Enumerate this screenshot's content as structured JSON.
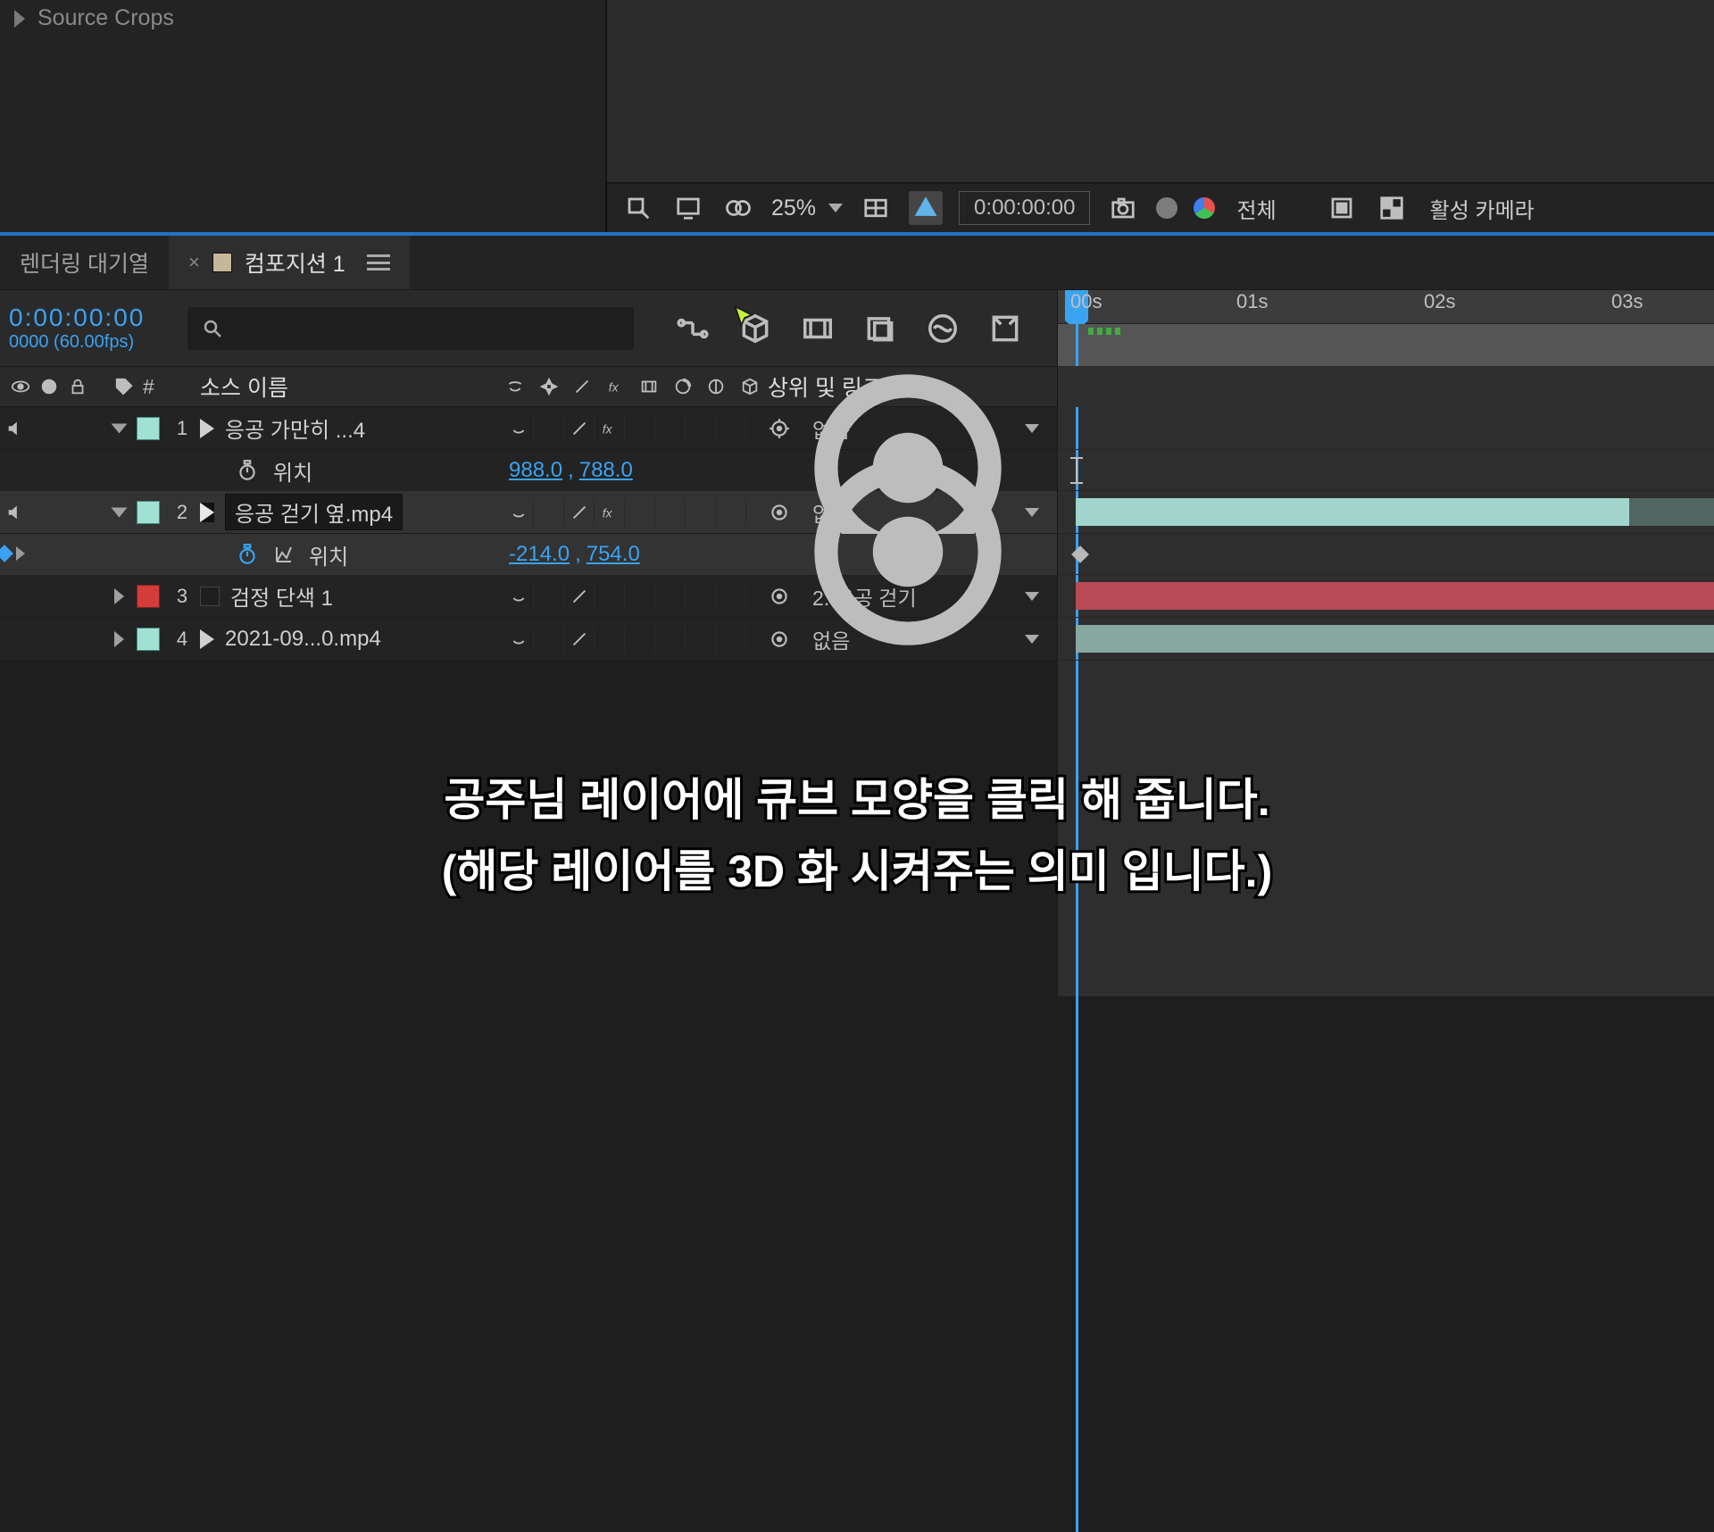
{
  "project": {
    "source_crops": "Source Crops"
  },
  "preview_toolbar": {
    "zoom": "25%",
    "timecode": "0:00:00:00",
    "resolution": "전체",
    "camera": "활성 카메라"
  },
  "tabs": {
    "render_queue": "렌더링 대기열",
    "comp": "컴포지션 1"
  },
  "timeline": {
    "current_time": "0:00:00:00",
    "fps": "0000 (60.00fps)",
    "search_placeholder": "",
    "ruler": [
      "00s",
      "01s",
      "02s",
      "03s"
    ]
  },
  "columns": {
    "index": "#",
    "source_name": "소스 이름",
    "parent_link": "상위 및 링크"
  },
  "layers": [
    {
      "index": "1",
      "name": "응공 가만히 ...4",
      "has_fx": true,
      "parent": "없음",
      "color": "teal",
      "props": [
        {
          "name": "위치",
          "values": [
            "988.0",
            "788.0"
          ],
          "animated": false
        }
      ]
    },
    {
      "index": "2",
      "name": "응공 걷기 옆.mp4",
      "has_fx": true,
      "parent": "없음",
      "color": "teal",
      "selected": true,
      "props": [
        {
          "name": "위치",
          "values": [
            "-214.0",
            "754.0"
          ],
          "animated": true
        }
      ]
    },
    {
      "index": "3",
      "name": "검정 단색 1",
      "has_fx": false,
      "parent": "2. 응공 걷기",
      "color": "red"
    },
    {
      "index": "4",
      "name": "2021-09...0.mp4",
      "has_fx": false,
      "parent": "없음",
      "color": "teal"
    }
  ],
  "caption": {
    "line1": "공주님 레이어에 큐브 모양을 클릭 해 줍니다.",
    "line2": "(해당 레이어를 3D 화 시켜주는 의미 입니다.)"
  }
}
